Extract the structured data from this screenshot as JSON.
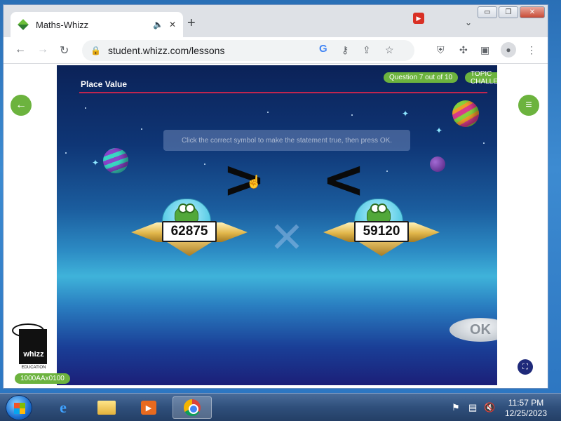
{
  "browser": {
    "tab_title": "Maths-Whizz",
    "tab_audio_icon": "speaker-icon",
    "tab_close": "✕",
    "new_tab": "+",
    "url": "student.whizz.com/lessons",
    "window_minimize": "▭",
    "window_restore": "❐",
    "window_close": "✕"
  },
  "lesson": {
    "title": "Place Value",
    "question_progress": "Question 7 out of 10",
    "challenge_label": "TOPIC CHALLENGE",
    "hint_text": "Click the correct symbol to make the statement true, then press OK.",
    "symbol_greater": ">",
    "symbol_less": "<",
    "left_number": "62875",
    "right_number": "59120",
    "ok_label": "OK",
    "user_id": "1000AAx0100",
    "logo_word": "whizz",
    "logo_sub": "EDUCATION"
  },
  "taskbar": {
    "time": "11:57 PM",
    "date": "12/25/2023"
  },
  "colors": {
    "accent_green": "#6cb33e",
    "title_line": "#c0254f"
  }
}
